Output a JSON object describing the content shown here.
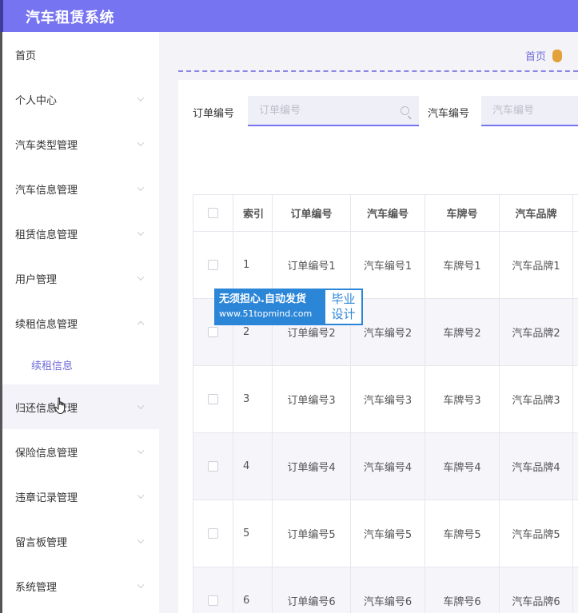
{
  "app": {
    "title": "汽车租赁系统"
  },
  "sidebar": {
    "items": [
      {
        "label": "首页",
        "expandable": false
      },
      {
        "label": "个人中心",
        "expandable": true
      },
      {
        "label": "汽车类型管理",
        "expandable": true
      },
      {
        "label": "汽车信息管理",
        "expandable": true
      },
      {
        "label": "租赁信息管理",
        "expandable": true
      },
      {
        "label": "用户管理",
        "expandable": true
      },
      {
        "label": "续租信息管理",
        "expandable": true,
        "expanded": true
      },
      {
        "label": "归还信息管理",
        "expandable": true,
        "hovered": true
      },
      {
        "label": "保险信息管理",
        "expandable": true
      },
      {
        "label": "违章记录管理",
        "expandable": true
      },
      {
        "label": "留言板管理",
        "expandable": true
      },
      {
        "label": "系统管理",
        "expandable": true
      }
    ],
    "submenu": {
      "label": "续租信息"
    }
  },
  "breadcrumb": {
    "home": "首页"
  },
  "search": {
    "order_label": "订单编号",
    "order_placeholder": "订单编号",
    "car_label": "汽车编号",
    "car_placeholder": "汽车编号"
  },
  "table": {
    "headers": [
      "",
      "索引",
      "订单编号",
      "汽车编号",
      "车牌号",
      "汽车品牌"
    ],
    "rows": [
      [
        "1",
        "订单编号1",
        "汽车编号1",
        "车牌号1",
        "汽车品牌1"
      ],
      [
        "2",
        "订单编号2",
        "汽车编号2",
        "车牌号2",
        "汽车品牌2"
      ],
      [
        "3",
        "订单编号3",
        "汽车编号3",
        "车牌号3",
        "汽车品牌3"
      ],
      [
        "4",
        "订单编号4",
        "汽车编号4",
        "车牌号4",
        "汽车品牌4"
      ],
      [
        "5",
        "订单编号5",
        "汽车编号5",
        "车牌号5",
        "汽车品牌5"
      ],
      [
        "6",
        "订单编号6",
        "汽车编号6",
        "车牌号6",
        "汽车品牌6"
      ]
    ]
  },
  "watermark": {
    "line1": "无须担心.自动发货",
    "line2": "www.51topmind.com",
    "side1": "毕业",
    "side2": "设计"
  },
  "colors": {
    "header_bg": "#7774f1",
    "accent": "#6f6cd8",
    "watermark_blue": "#2c86d8"
  }
}
